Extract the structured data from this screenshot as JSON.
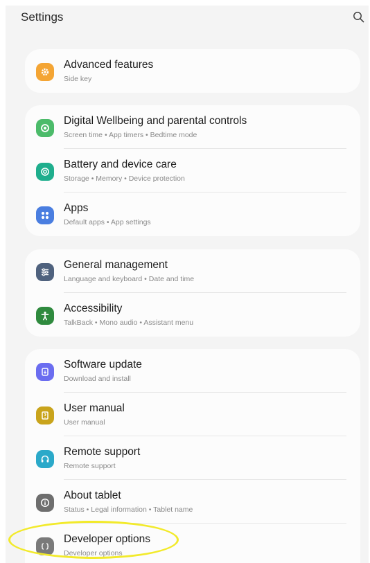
{
  "header": {
    "title": "Settings"
  },
  "groups": [
    [
      {
        "title": "Advanced features",
        "subtitle": "Side key",
        "icon": "advanced-features-icon",
        "color": "#f4a534"
      }
    ],
    [
      {
        "title": "Digital Wellbeing and parental controls",
        "subtitle": "Screen time  •  App timers  •  Bedtime mode",
        "icon": "digital-wellbeing-icon",
        "color": "#4cbb6a"
      },
      {
        "title": "Battery and device care",
        "subtitle": "Storage  •  Memory  •  Device protection",
        "icon": "device-care-icon",
        "color": "#1fae8d"
      },
      {
        "title": "Apps",
        "subtitle": "Default apps  •  App settings",
        "icon": "apps-icon",
        "color": "#4a7ee0"
      }
    ],
    [
      {
        "title": "General management",
        "subtitle": "Language and keyboard  •  Date and time",
        "icon": "general-management-icon",
        "color": "#4f627e"
      },
      {
        "title": "Accessibility",
        "subtitle": "TalkBack  •  Mono audio  •  Assistant menu",
        "icon": "accessibility-icon",
        "color": "#2f8a3e"
      }
    ],
    [
      {
        "title": "Software update",
        "subtitle": "Download and install",
        "icon": "software-update-icon",
        "color": "#6b6df0"
      },
      {
        "title": "User manual",
        "subtitle": "User manual",
        "icon": "user-manual-icon",
        "color": "#c9a41c"
      },
      {
        "title": "Remote support",
        "subtitle": "Remote support",
        "icon": "remote-support-icon",
        "color": "#2ba9c9"
      },
      {
        "title": "About tablet",
        "subtitle": "Status  •  Legal information  •  Tablet name",
        "icon": "about-tablet-icon",
        "color": "#6e6e6e"
      },
      {
        "title": "Developer options",
        "subtitle": "Developer options",
        "icon": "developer-options-icon",
        "color": "#7a7a7a"
      }
    ]
  ],
  "annotation": {
    "color": "#f2ea2b"
  }
}
